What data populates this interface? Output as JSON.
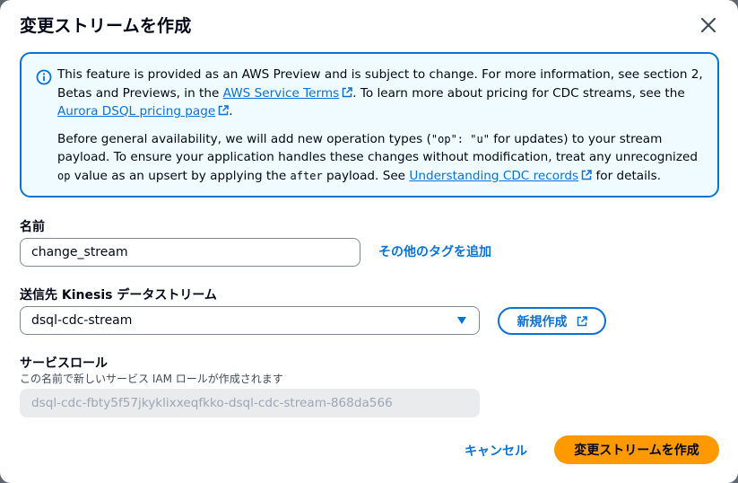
{
  "dialog": {
    "title": "変更ストリームを作成"
  },
  "info": {
    "p1_a": "This feature is provided as an AWS Preview and is subject to change. For more information, see section 2, Betas and Previews, in the ",
    "p1_link1": "AWS Service Terms",
    "p1_b": ". To learn more about pricing for CDC streams, see the ",
    "p1_link2": "Aurora DSQL pricing page",
    "p1_c": ".",
    "p2_a": "Before general availability, we will add new operation types (",
    "p2_code1": "\"op\": \"u\"",
    "p2_b": " for updates) to your stream payload. To ensure your application handles these changes without modification, treat any unrecognized ",
    "p2_code2": "op",
    "p2_c": " value as an upsert by applying the ",
    "p2_code3": "after",
    "p2_d": " payload. See ",
    "p2_link": "Understanding CDC records",
    "p2_e": " for details."
  },
  "name_field": {
    "label": "名前",
    "value": "change_stream",
    "add_tags_label": "その他のタグを追加"
  },
  "destination_field": {
    "label": "送信先 Kinesis データストリーム",
    "selected": "dsql-cdc-stream",
    "create_new_label": "新規作成"
  },
  "service_role_field": {
    "label": "サービスロール",
    "description": "この名前で新しいサービス IAM ロールが作成されます",
    "value": "dsql-cdc-fbty5f57jkyklixxeqfkko-dsql-cdc-stream-868da566"
  },
  "footer": {
    "cancel_label": "キャンセル",
    "submit_label": "変更ストリームを作成"
  },
  "colors": {
    "accent": "#0972d3",
    "primary_button": "#ff9900",
    "info_background": "#f0fbff"
  }
}
